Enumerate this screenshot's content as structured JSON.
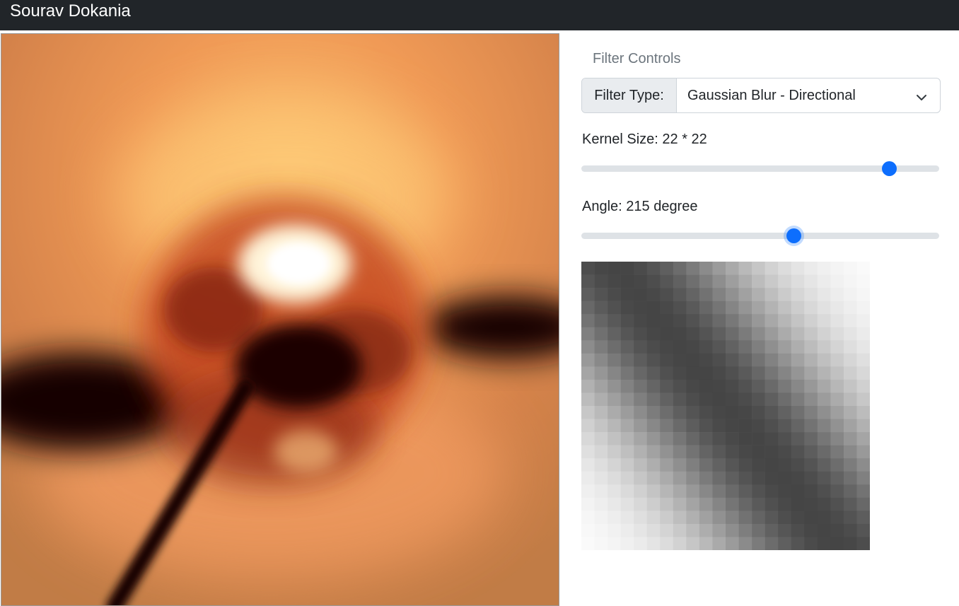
{
  "navbar": {
    "brand": "Sourav Dokania"
  },
  "image": {
    "description_icon": "blurred-photo",
    "palette": [
      "#c98548",
      "#f4a35f",
      "#fff6e0",
      "#100303"
    ]
  },
  "controls": {
    "legend": "Filter Controls",
    "filter_type": {
      "label": "Filter Type:",
      "selected": "Gaussian Blur - Directional"
    },
    "kernel_size": {
      "label": "Kernel Size: 22 * 22",
      "value": 22,
      "min": 1,
      "max": 25
    },
    "angle": {
      "label": "Angle: 215 degree",
      "value": 215,
      "min": 0,
      "max": 360
    }
  },
  "kernel_preview": {
    "size": 22,
    "angle_degrees": 215,
    "colors": {
      "dark": "#454545",
      "light": "#ffffff"
    }
  },
  "colors": {
    "accent": "#0d6efd",
    "navbar": "#212529",
    "track": "#dee2e6"
  }
}
